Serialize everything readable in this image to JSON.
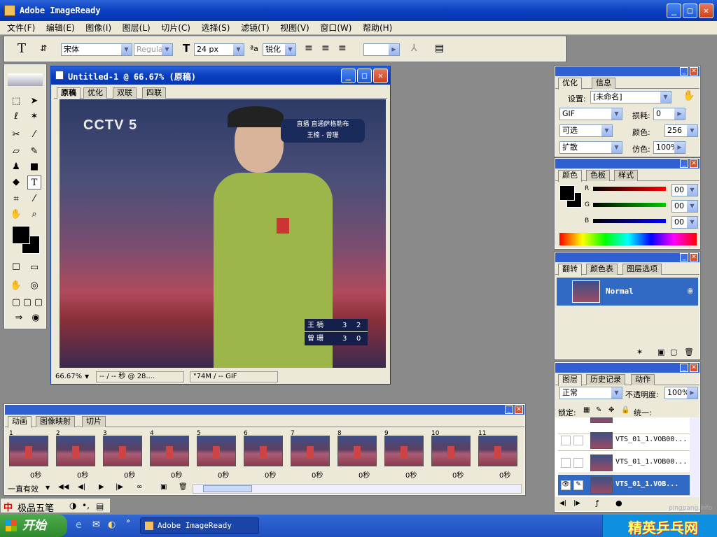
{
  "app": {
    "title": "Adobe ImageReady"
  },
  "menu": [
    "文件(F)",
    "编辑(E)",
    "图像(I)",
    "图层(L)",
    "切片(C)",
    "选择(S)",
    "滤镜(T)",
    "视图(V)",
    "窗口(W)",
    "帮助(H)"
  ],
  "options": {
    "tool_glyph": "T",
    "font": "宋体",
    "style": "Regular",
    "size": "24 px",
    "aa_label": "ªa",
    "aa": "锐化",
    "color_value": ""
  },
  "doc": {
    "title": "Untitled-1 @ 66.67% (原稿)",
    "tabs": [
      "原稿",
      "优化",
      "双联",
      "四联"
    ],
    "status_zoom": "66.67%",
    "status_time": "-- / -- 秒 @ 28....",
    "status_size": "\"74M / -- GIF",
    "logo": "CCTV 5",
    "banner1": "直播 直通萨格勒布",
    "banner2": "王楠 - 曾珊",
    "score": [
      {
        "name": "王 楠",
        "a": "3",
        "b": "2"
      },
      {
        "name": "曾 珊",
        "a": "3",
        "b": "0"
      }
    ]
  },
  "optimize": {
    "tabs": [
      "优化",
      "信息"
    ],
    "setting_label": "设置:",
    "setting": "[未命名]",
    "format": "GIF",
    "lossy_label": "损耗:",
    "lossy": "0",
    "reduction": "可选",
    "colors_label": "颜色:",
    "colors": "256",
    "dither": "扩散",
    "dither_label": "仿色:",
    "dither_pct": "100%"
  },
  "color": {
    "tabs": [
      "颜色",
      "色板",
      "样式"
    ],
    "r_label": "R",
    "g_label": "G",
    "b_label": "B",
    "r": "00",
    "g": "00",
    "b": "00"
  },
  "rollover": {
    "tabs": [
      "翻转",
      "颜色表",
      "图层选项"
    ],
    "state": "Normal"
  },
  "layers": {
    "tabs": [
      "图层",
      "历史记录",
      "动作"
    ],
    "blend": "正常",
    "opacity_label": "不透明度:",
    "opacity": "100%",
    "lock_label": "锁定:",
    "unify_label": "统一:",
    "items": [
      "VTS_01_1.VOB00...",
      "VTS_01_1.VOB00...",
      "VTS_01_1.VOB..."
    ]
  },
  "animation": {
    "tabs": [
      "动画",
      "图像映射",
      "切片"
    ],
    "loop": "一直有效",
    "frames": [
      {
        "num": "1",
        "dur": "0秒"
      },
      {
        "num": "2",
        "dur": "0秒"
      },
      {
        "num": "3",
        "dur": "0秒"
      },
      {
        "num": "4",
        "dur": "0秒"
      },
      {
        "num": "5",
        "dur": "0秒"
      },
      {
        "num": "6",
        "dur": "0秒"
      },
      {
        "num": "7",
        "dur": "0秒"
      },
      {
        "num": "8",
        "dur": "0秒"
      },
      {
        "num": "9",
        "dur": "0秒"
      },
      {
        "num": "10",
        "dur": "0秒"
      },
      {
        "num": "11",
        "dur": "0秒"
      }
    ]
  },
  "ime": {
    "label": "极品五笔",
    "moon": "◑",
    "dots": "•,"
  },
  "taskbar": {
    "start": "开始",
    "task": "Adobe ImageReady"
  },
  "watermark": {
    "site": "pingpang.info",
    "logo": "精英乒乓网"
  }
}
